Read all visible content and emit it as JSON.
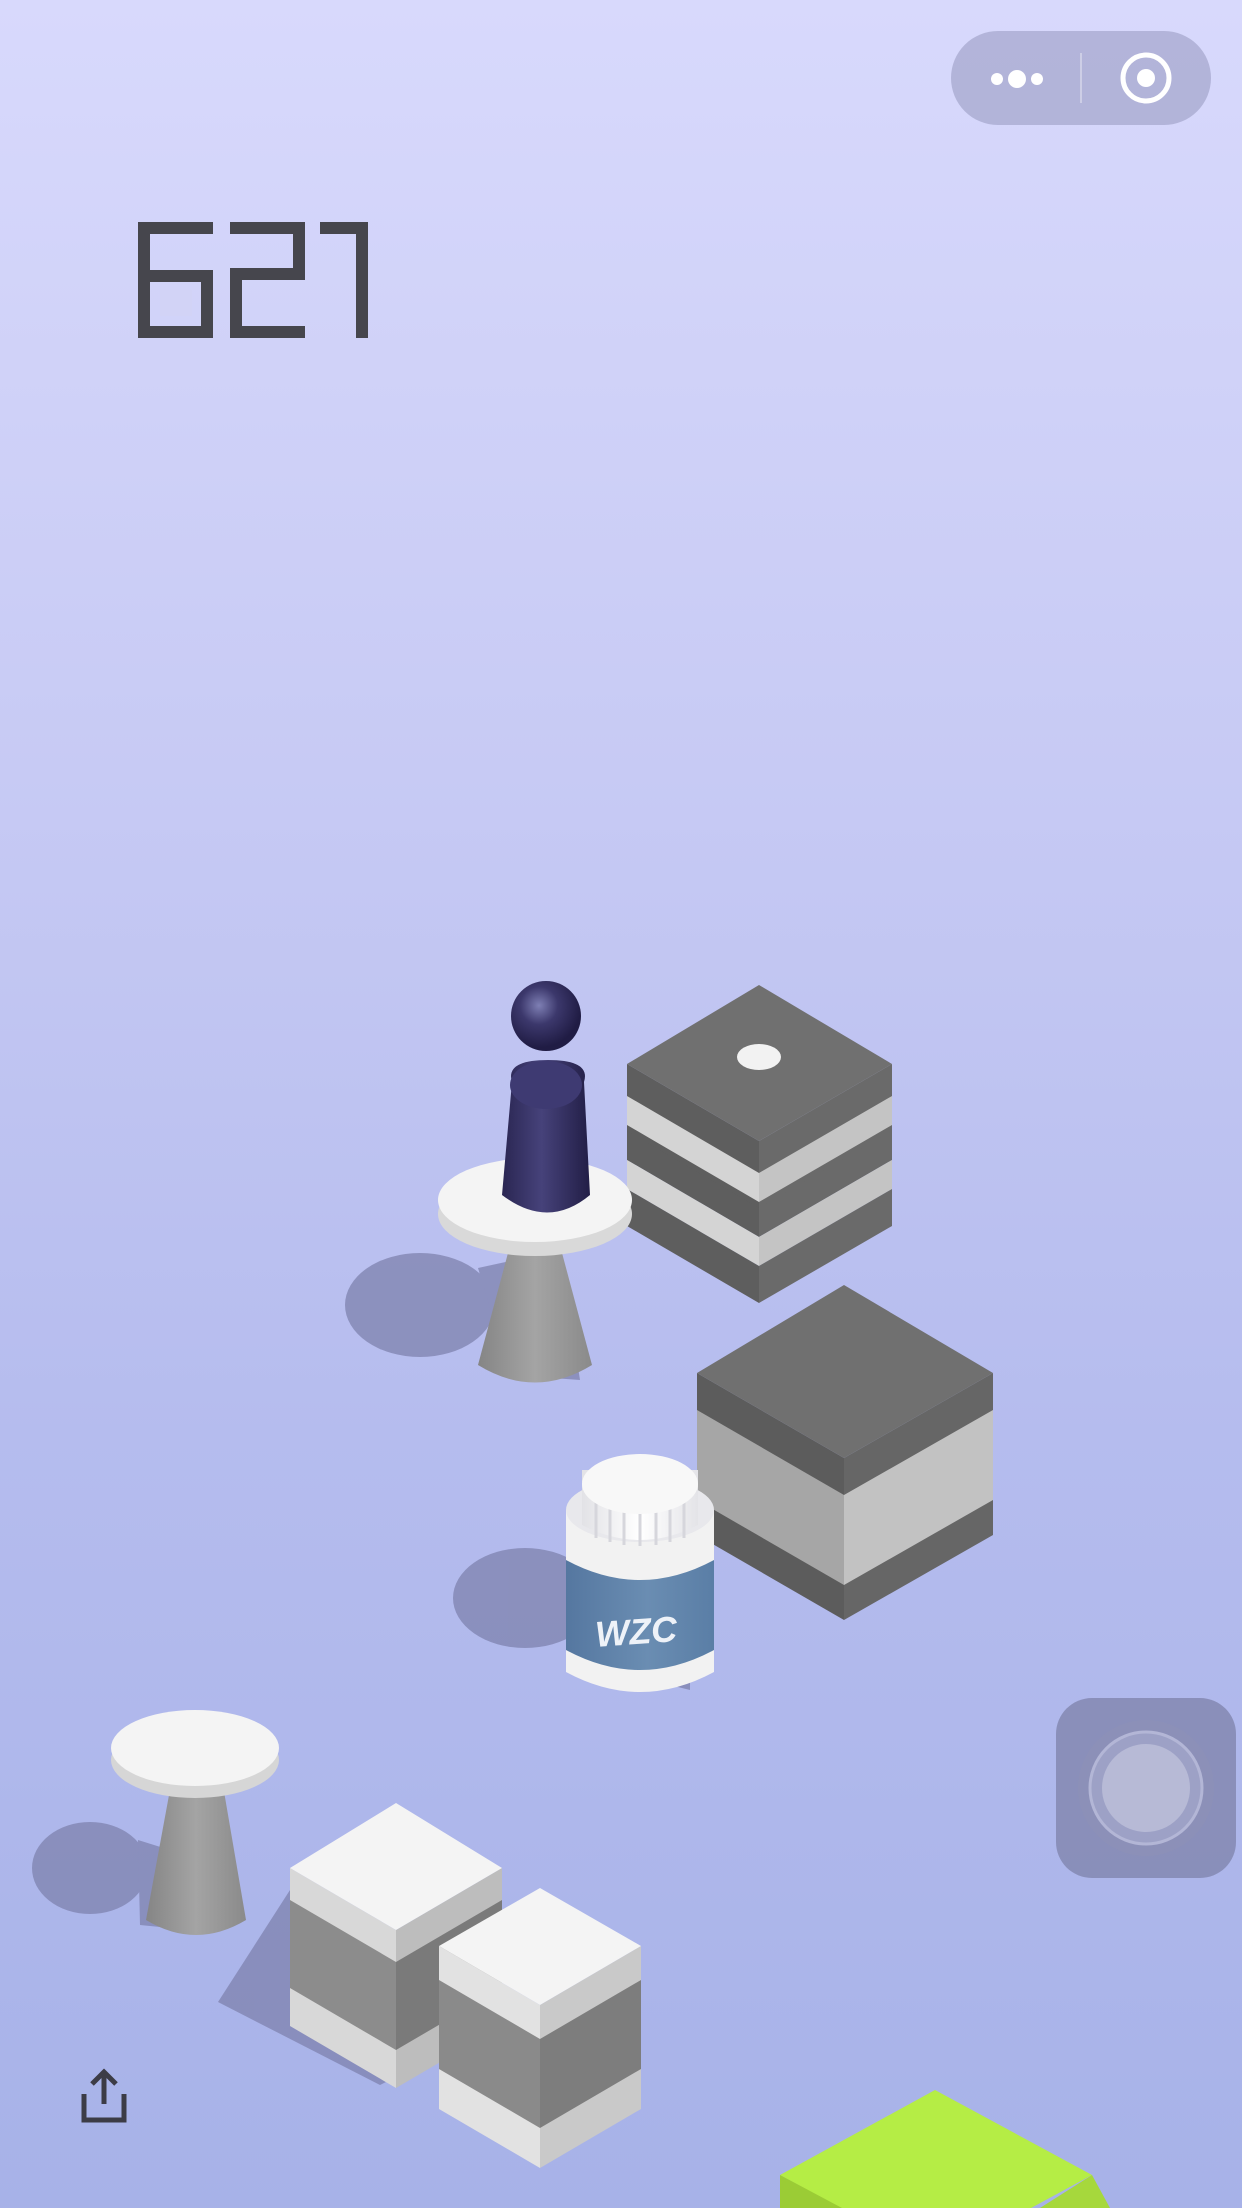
{
  "score": "621",
  "bottle_label": "WZC",
  "icons": {
    "menu": "more-dots-icon",
    "close": "target-circle-icon",
    "share": "share-upload-icon"
  },
  "colors": {
    "background_top": "#d8d9fc",
    "background_bottom": "#a7b2e8",
    "score": "#46464d",
    "piece": "#343060",
    "dark_block_top": "#707070",
    "bottle_label": "#5f84a8",
    "green_block": "#b5ed45"
  }
}
